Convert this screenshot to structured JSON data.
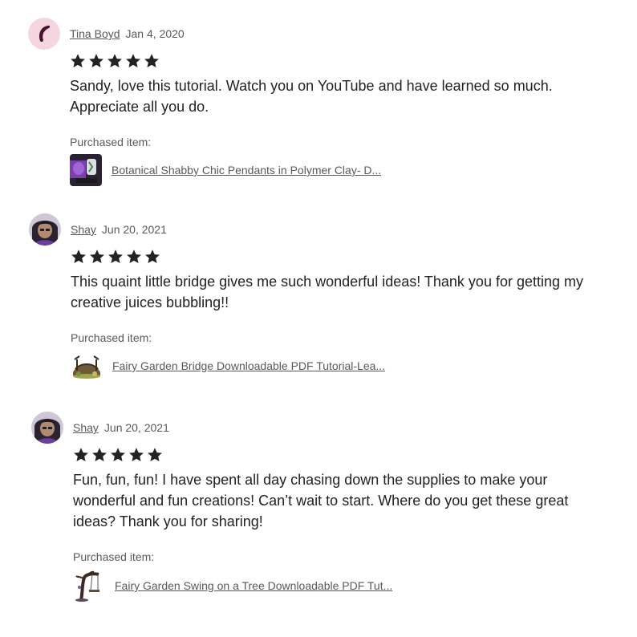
{
  "reviews": [
    {
      "reviewer": "Tina Boyd",
      "date": "Jan 4, 2020",
      "rating": 5,
      "text": "Sandy, love this tutorial. Watch you on YouTube and have learned so much. Appreciate all you do.",
      "purchased_label": "Purchased item:",
      "item_title": "Botanical Shabby Chic Pendants in Polymer Clay- D..."
    },
    {
      "reviewer": "Shay",
      "date": "Jun 20, 2021",
      "rating": 5,
      "text": "This quaint little bridge gives me such wonderful ideas! Thank you for getting my creative juices bubbling!!",
      "purchased_label": "Purchased item:",
      "item_title": "Fairy Garden Bridge Downloadable PDF Tutorial-Lea..."
    },
    {
      "reviewer": "Shay",
      "date": "Jun 20, 2021",
      "rating": 5,
      "text": "Fun, fun, fun! I have spent all day chasing down the supplies to make your wonderful and fun creations! Can’t wait to start. Where do you get these great ideas? Thank you for sharing!",
      "purchased_label": "Purchased item:",
      "item_title": "Fairy Garden Swing on a Tree Downloadable PDF Tut..."
    }
  ],
  "colors": {
    "star": "#222222",
    "link": "#595959",
    "avatar_bg": "#f5d6e0",
    "avatar_mark": "#4a1030"
  },
  "icons": {
    "star": "star-icon",
    "default_avatar": "crescent-avatar-icon"
  }
}
